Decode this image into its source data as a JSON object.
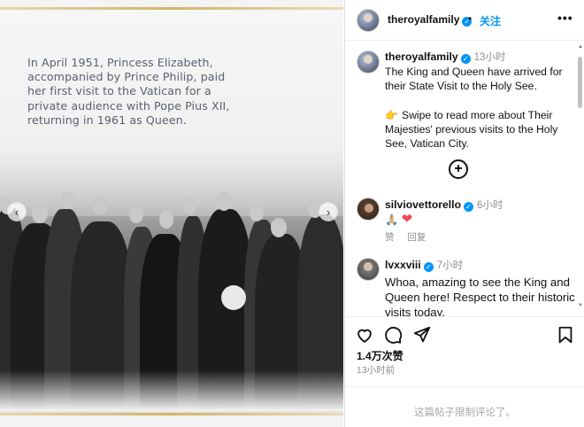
{
  "media": {
    "caption": "In April 1951, Princess Elizabeth, accompanied by Prince Philip, paid her first visit to the Vatican for a private audience with Pope Pius XII, returning in 1961 as Queen.",
    "prev_icon": "chevron-left-icon",
    "next_icon": "chevron-right-icon"
  },
  "header": {
    "username": "theroyalfamily",
    "verified_icon": "verified-badge-icon",
    "separator": "•",
    "follow_label": "关注",
    "more_icon": "more-horizontal-icon"
  },
  "caption": {
    "username": "theroyalfamily",
    "time": "13小时",
    "line1": "The King and Queen have arrived for their State Visit to the Holy See.",
    "line2": "Swipe to read more about Their Majesties' previous visits to the Holy See, Vatican City.",
    "hand_icon": "pointing-hand-emoji"
  },
  "load_more_icon": "plus-circle-icon",
  "comments": [
    {
      "username": "silviovettorello",
      "verified": true,
      "time": "6小时",
      "text": "🙏🏼 ❤",
      "like_label": "赞",
      "reply_label": "回复"
    },
    {
      "username": "lvxxviii",
      "verified": true,
      "time": "7小时",
      "text": "Whoa, amazing to see the King and Queen here! Respect to their historic visits today."
    }
  ],
  "actions": {
    "like_icon": "heart-outline-icon",
    "comment_icon": "comment-icon",
    "share_icon": "send-icon",
    "save_icon": "bookmark-icon"
  },
  "likes_text": "1.4万次赞",
  "posted_time": "13小时前",
  "comments_restricted": "这篇帖子限制评论了。",
  "colors": {
    "accent": "#0095f6",
    "heart": "#ed4956",
    "muted": "#8e8e8e",
    "gold": "#d4b46a"
  }
}
